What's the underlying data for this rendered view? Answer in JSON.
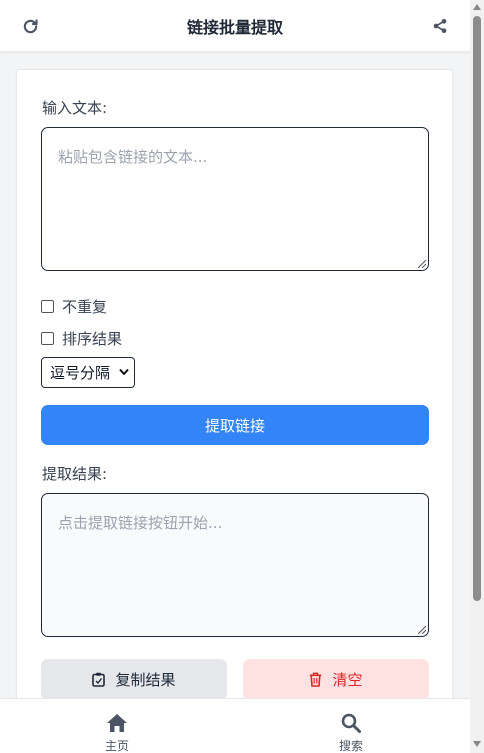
{
  "header": {
    "title": "链接批量提取",
    "left_icon": "refresh-icon",
    "right_icon": "share-icon"
  },
  "form": {
    "input_label": "输入文本:",
    "input_placeholder": "粘贴包含链接的文本...",
    "option_unique": "不重复",
    "option_sort": "排序结果",
    "separator_selected": "逗号分隔",
    "extract_button": "提取链接",
    "output_label": "提取结果:",
    "output_placeholder": "点击提取链接按钮开始...",
    "copy_button": "复制结果",
    "clear_button": "清空"
  },
  "nav": {
    "home": "主页",
    "search": "搜索"
  },
  "colors": {
    "primary": "#3385f7",
    "danger": "#dc2626",
    "danger_bg": "#fee2e2"
  }
}
